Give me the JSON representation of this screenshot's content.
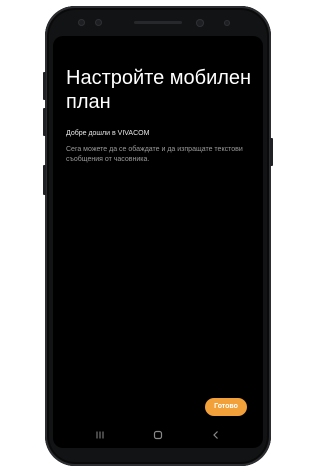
{
  "setup": {
    "title": "Настройте мобилен план",
    "welcome": "Добре дошли в VIVACOM",
    "description": "Сега можете да се обаждате и да изпращате текстови съобщения от часовника.",
    "done_label": "Готово"
  },
  "navbar": {
    "recent_icon": "recent-apps-icon",
    "home_icon": "home-icon",
    "back_icon": "back-icon"
  },
  "colors": {
    "accent": "#f2a13a",
    "screen_bg": "#000000",
    "title_text": "#ffffff",
    "secondary_text": "#9a9a9a"
  }
}
